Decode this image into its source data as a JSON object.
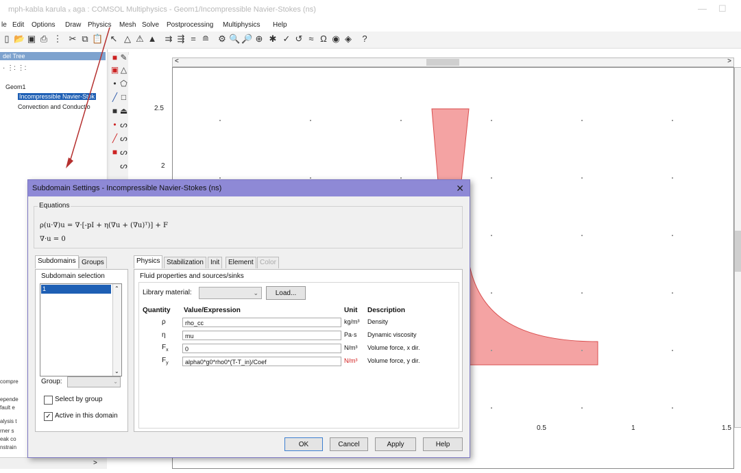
{
  "window": {
    "title": "mph-kabla karula ₓ aga : COMSOL Multiphysics - Geom1/Incompressible Navier-Stokes (ns)"
  },
  "menu": [
    "le",
    "Edit",
    "Options",
    "Draw",
    "Physics",
    "Mesh",
    "Solve",
    "Postprocessing",
    "Multiphysics",
    "Help"
  ],
  "model_tree": {
    "header": "del Tree",
    "root": "Geom1",
    "items": [
      "Incompressible Navier-Stok",
      "Convection and Conductio"
    ]
  },
  "left_lower": [
    "compre",
    "epende",
    "fault e",
    "alysis t",
    "rner s",
    "eak co",
    "nstrain"
  ],
  "plot": {
    "y_ticks": [
      "2.5",
      "2"
    ],
    "x_ticks": [
      "0.5",
      "1",
      "1.5"
    ],
    "shape_fill": "#f4a3a3",
    "shape_stroke": "#d94c4c"
  },
  "dialog": {
    "title": "Subdomain Settings - Incompressible Navier-Stokes (ns)",
    "equations_label": "Equations",
    "equation1": "ρ(u·∇)u = ∇·[-pI + η(∇u + (∇u)ᵀ)] + F",
    "equation2": "∇·u = 0",
    "left_tabs": [
      "Subdomains",
      "Groups"
    ],
    "subdomain_selection_label": "Subdomain selection",
    "subdomain_items": [
      "1"
    ],
    "group_label": "Group:",
    "select_by_group": "Select by group",
    "active_in_domain": "Active in this domain",
    "right_tabs": [
      "Physics",
      "Stabilization",
      "Init",
      "Element",
      "Color"
    ],
    "fluid_section": "Fluid properties and sources/sinks",
    "library_material_label": "Library material:",
    "load_button": "Load...",
    "headers": {
      "quantity": "Quantity",
      "value": "Value/Expression",
      "unit": "Unit",
      "description": "Description"
    },
    "rows": [
      {
        "quantity": "ρ",
        "sub": "",
        "value": "rho_cc",
        "unit": "kg/m³",
        "unit_red": false,
        "description": "Density"
      },
      {
        "quantity": "η",
        "sub": "",
        "value": "mu",
        "unit": "Pa·s",
        "unit_red": false,
        "description": "Dynamic viscosity"
      },
      {
        "quantity": "F",
        "sub": "x",
        "value": "0",
        "unit": "N/m³",
        "unit_red": false,
        "description": "Volume force, x dir."
      },
      {
        "quantity": "F",
        "sub": "y",
        "value": "alpha0*g0*rho0*(T-T_in)/Coef",
        "unit": "N/m³",
        "unit_red": true,
        "description": "Volume force, y dir."
      }
    ],
    "buttons": {
      "ok": "OK",
      "cancel": "Cancel",
      "apply": "Apply",
      "help": "Help"
    },
    "close_glyph": "✕"
  },
  "annotation_color": "#b5302f"
}
